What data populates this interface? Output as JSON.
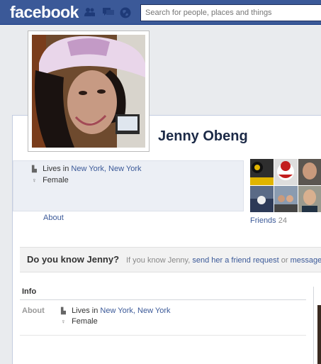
{
  "header": {
    "logo": "facebook",
    "search_placeholder": "Search for people, places and things",
    "icons": [
      "friend-requests-icon",
      "messages-icon",
      "notifications-icon"
    ]
  },
  "profile": {
    "name": "Jenny Obeng",
    "lives_in_prefix": "Lives in",
    "location": "New York, New York",
    "gender": "Female",
    "about_link": "About",
    "friends_label": "Friends",
    "friends_count": "24"
  },
  "know_bar": {
    "title": "Do you know Jenny?",
    "text": "If you know Jenny,",
    "link": "send her a friend request",
    "or": "or",
    "message_link": "message"
  },
  "info": {
    "section_title": "Info",
    "about_label": "About",
    "lives_in_prefix": "Lives in",
    "location": "New York, New York",
    "gender": "Female"
  },
  "colors": {
    "brand": "#3b5998",
    "background": "#e9ebee",
    "link": "#3b5998"
  }
}
